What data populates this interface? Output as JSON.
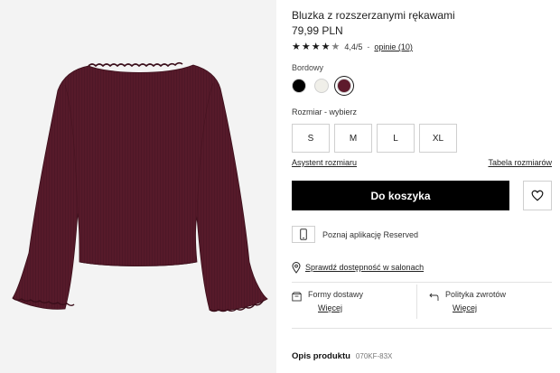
{
  "product": {
    "title": "Bluzka z rozszerzanymi rękawami",
    "price": "79,99 PLN",
    "image_alt": "product-photo-burgundy-blouse"
  },
  "rating": {
    "stars": 4.4,
    "value": "4,4/5",
    "separator": "-",
    "reviews_label": "opinie (10)"
  },
  "color": {
    "selected_label": "Bordowy",
    "swatches": [
      {
        "name": "black",
        "hex": "#000000"
      },
      {
        "name": "cream",
        "hex": "#f0efe9"
      },
      {
        "name": "burgundy",
        "hex": "#5e1a2c"
      }
    ],
    "selected_index": 2
  },
  "size": {
    "label": "Rozmiar -  wybierz",
    "options": [
      "S",
      "M",
      "L",
      "XL"
    ],
    "assistant_label": "Asystent rozmiaru",
    "table_label": "Tabela rozmiarów"
  },
  "actions": {
    "add_to_cart_label": "Do koszyka",
    "wishlist_icon": "heart-icon"
  },
  "app_promo": {
    "label": "Poznaj aplikację Reserved",
    "icon": "phone-icon"
  },
  "stores": {
    "label": "Sprawdź dostępność w salonach",
    "icon": "map-pin-icon"
  },
  "shipping": {
    "title": "Formy dostawy",
    "link": "Więcej",
    "icon": "delivery-box-icon"
  },
  "returns": {
    "title": "Polityka zwrotów",
    "link": "Więcej",
    "icon": "return-arrow-icon"
  },
  "description": {
    "title": "Opis produktu",
    "code": "070KF-83X"
  },
  "colors": {
    "accent": "#000000",
    "product": "#5e1a2c",
    "background_gallery": "#f3f3f3"
  }
}
